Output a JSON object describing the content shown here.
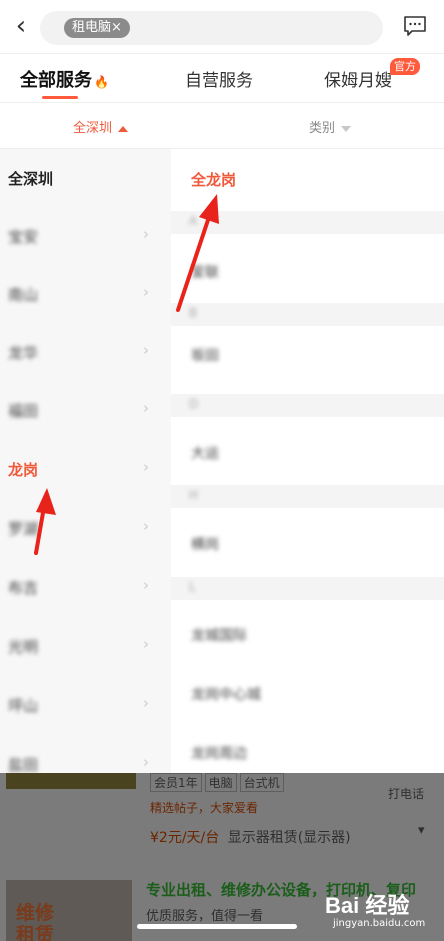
{
  "header": {
    "search_chip": "租电脑×"
  },
  "tabs": [
    {
      "label": "全部服务"
    },
    {
      "label": "自营服务"
    },
    {
      "label": "保姆月嫂"
    }
  ],
  "tab_badge": "官方",
  "filters": {
    "area": "全深圳",
    "category": "类别"
  },
  "districts": [
    {
      "label": "全深圳"
    },
    {
      "label": "宝安"
    },
    {
      "label": "南山"
    },
    {
      "label": "龙华"
    },
    {
      "label": "福田"
    },
    {
      "label": "龙岗"
    },
    {
      "label": "罗湖"
    },
    {
      "label": "布吉"
    },
    {
      "label": "光明"
    },
    {
      "label": "坪山"
    },
    {
      "label": "盐田"
    }
  ],
  "subareas": {
    "all": "全龙岗",
    "groups": [
      {
        "letter": "A",
        "items": [
          "爱联"
        ]
      },
      {
        "letter": "B",
        "items": [
          "坂田"
        ]
      },
      {
        "letter": "D",
        "items": [
          "大运"
        ]
      },
      {
        "letter": "H",
        "items": [
          "横岗"
        ]
      },
      {
        "letter": "L",
        "items": [
          "龙城国际",
          "龙岗中心城",
          "龙岗周边"
        ]
      }
    ]
  },
  "background": {
    "tags": [
      "会员1年",
      "电脑",
      "台式机"
    ],
    "phone": "打电话",
    "note": "精选帖子，大家爱看",
    "price": "¥2元/天/台",
    "product": "显示器租赁(显示器)",
    "ad_title": "专业出租、维修办公设备，打印机、复印",
    "ad_sub": "优质服务，值得一看",
    "ad_image_text": "维修 租赁"
  },
  "watermark": {
    "brand": "Bai 经验",
    "url": "jingyan.baidu.com"
  },
  "colors": {
    "accent": "#f05a3c",
    "annotation_arrow": "#e8231b"
  }
}
